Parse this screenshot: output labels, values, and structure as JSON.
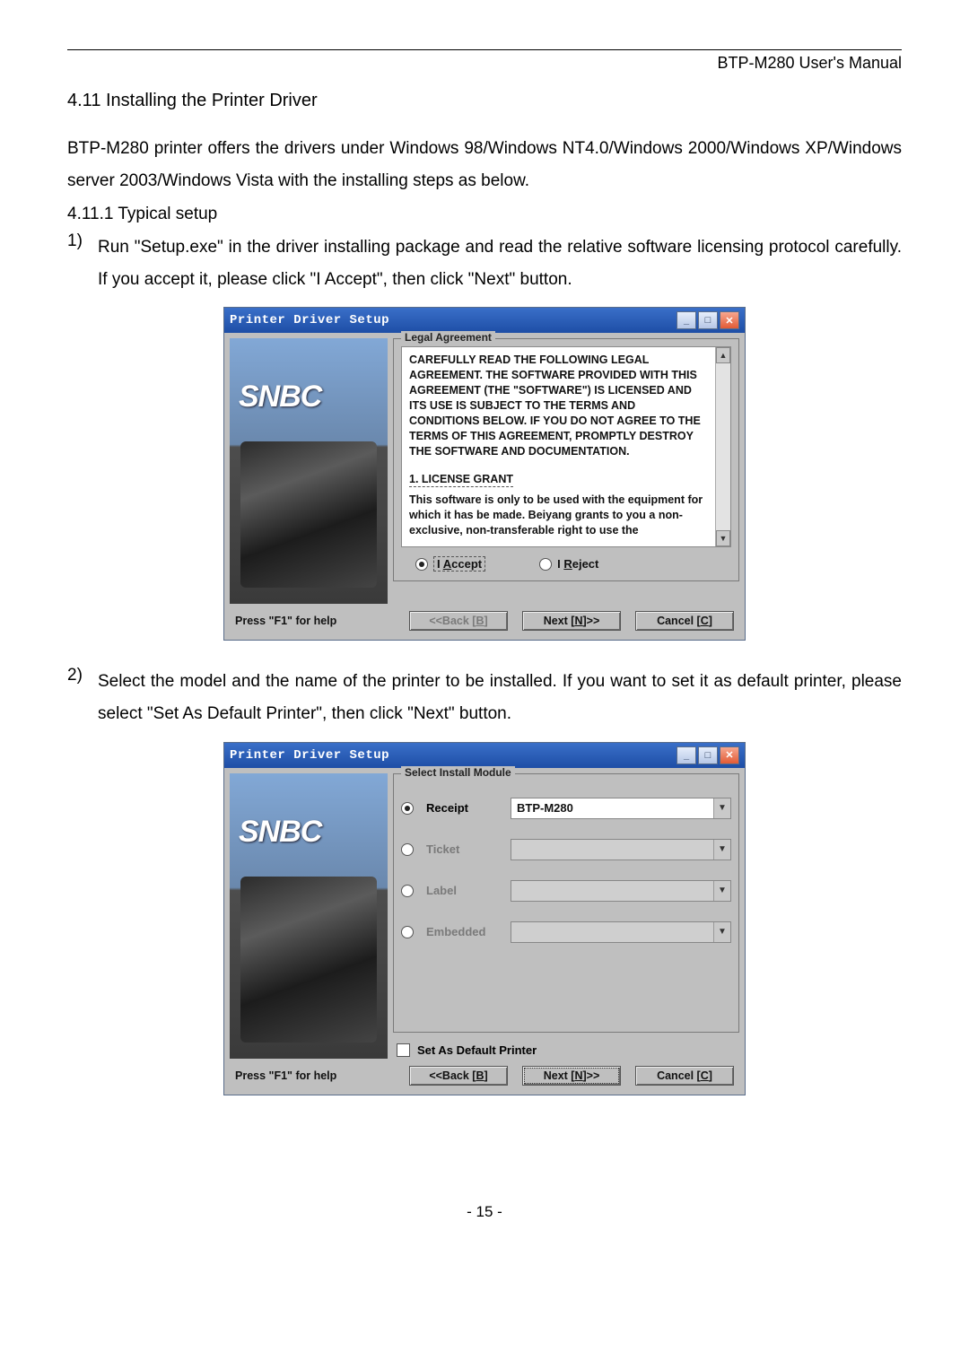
{
  "header": {
    "title": "BTP-M280 User's Manual"
  },
  "section": {
    "heading": "4.11 Installing the Printer Driver",
    "paragraph1": "BTP-M280 printer offers the drivers under Windows 98/Windows NT4.0/Windows 2000/Windows XP/Windows server 2003/Windows Vista with the installing steps as below.",
    "sub1": "4.11.1 Typical setup",
    "step1_num": "1)",
    "step1_text": "Run \"Setup.exe\" in the driver installing package and read the relative software licensing protocol carefully. If you accept it, please click \"I Accept\", then click \"Next\" button.",
    "step2_num": "2)",
    "step2_text": "Select the model and the name of the printer to be installed. If you want to set it as default printer, please select \"Set As Default Printer\", then click \"Next\" button."
  },
  "dialog1": {
    "title": "Printer Driver Setup",
    "side_logo": "SNBC",
    "groupbox_title": "Legal Agreement",
    "license_p1": "CAREFULLY READ THE FOLLOWING LEGAL AGREEMENT. THE SOFTWARE PROVIDED WITH THIS AGREEMENT (THE \"SOFTWARE\") IS LICENSED AND ITS USE IS SUBJECT TO THE TERMS AND CONDITIONS BELOW. IF YOU DO NOT AGREE TO THE TERMS OF THIS AGREEMENT, PROMPTLY DESTROY THE SOFTWARE AND DOCUMENTATION.",
    "license_sec_title": "1. LICENSE GRANT",
    "license_p2": "This software is only to be used with the equipment for which it has be made. Beiyang grants to you a non-exclusive, non-transferable right to use the",
    "accept_prefix": "I ",
    "accept_u": "A",
    "accept_suffix": "ccept",
    "reject_prefix": "I ",
    "reject_u": "R",
    "reject_suffix": "eject",
    "help": "Press \"F1\" for help",
    "back_prefix": "<<Back [",
    "back_u": "B",
    "back_suffix": "]",
    "next_prefix": "Next [",
    "next_u": "N",
    "next_suffix": "]>>",
    "cancel_prefix": "Cancel [",
    "cancel_u": "C",
    "cancel_suffix": "]"
  },
  "dialog2": {
    "title": "Printer Driver Setup",
    "side_logo": "SNBC",
    "groupbox_title": "Select Install Module",
    "options": {
      "receipt_label": "Receipt",
      "receipt_value": "BTP-M280",
      "ticket_label": "Ticket",
      "ticket_value": "",
      "label_label": "Label",
      "label_value": "",
      "embedded_label": "Embedded",
      "embedded_value": ""
    },
    "checkbox_label": "Set As Default Printer",
    "help": "Press \"F1\" for help",
    "back_prefix": "<<Back [",
    "back_u": "B",
    "back_suffix": "]",
    "next_prefix": "Next [",
    "next_u": "N",
    "next_suffix": "]>>",
    "cancel_prefix": "Cancel [",
    "cancel_u": "C",
    "cancel_suffix": "]"
  },
  "page_number": "- 15 -"
}
